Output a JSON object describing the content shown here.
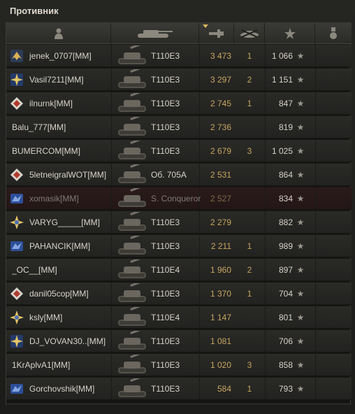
{
  "title": "Противник",
  "header": {
    "icons": [
      "player-icon",
      "tank-icon",
      "damage-icon",
      "kills-icon",
      "xp-star-icon",
      "medal-icon"
    ]
  },
  "colors": {
    "damage": "#c8a660",
    "text": "#d7d3c8",
    "dead_row": "#2b1b1b"
  },
  "rows": [
    {
      "name": "jenek_0707[MM]",
      "badge": "gold",
      "tank": "T110E3",
      "damage": "3 473",
      "kills": "1",
      "xp": "1 066",
      "dead": false
    },
    {
      "name": "Vasil7211[MM]",
      "badge": "star-blue",
      "tank": "T110E3",
      "damage": "3 297",
      "kills": "2",
      "xp": "1 151",
      "dead": false
    },
    {
      "name": "ilnurnk[MM]",
      "badge": "diamond-red",
      "tank": "T110E3",
      "damage": "2 745",
      "kills": "1",
      "xp": "847",
      "dead": false
    },
    {
      "name": "Balu_777[MM]",
      "badge": "",
      "tank": "T110E3",
      "damage": "2 736",
      "kills": "",
      "xp": "819",
      "dead": false
    },
    {
      "name": "BUMERCOM[MM]",
      "badge": "",
      "tank": "T110E3",
      "damage": "2 679",
      "kills": "3",
      "xp": "1 025",
      "dead": false
    },
    {
      "name": "5letneigralWOT[MM]",
      "badge": "diamond-red",
      "tank": "Об. 705А",
      "damage": "2 531",
      "kills": "",
      "xp": "864",
      "dead": false
    },
    {
      "name": "xomasik[MM]",
      "badge": "blue-wing",
      "tank": "S. Conqueror",
      "damage": "2 527",
      "kills": "",
      "xp": "834",
      "dead": true
    },
    {
      "name": "VARYG_____[MM]",
      "badge": "star-gold",
      "tank": "T110E3",
      "damage": "2 279",
      "kills": "",
      "xp": "882",
      "dead": false
    },
    {
      "name": "PAHANCIK[MM]",
      "badge": "blue-wing",
      "tank": "T110E3",
      "damage": "2 211",
      "kills": "1",
      "xp": "989",
      "dead": false
    },
    {
      "name": "_OC__[MM]",
      "badge": "",
      "tank": "T110E4",
      "damage": "1 960",
      "kills": "2",
      "xp": "897",
      "dead": false
    },
    {
      "name": "danil05cop[MM]",
      "badge": "diamond-red",
      "tank": "T110E3",
      "damage": "1 370",
      "kills": "1",
      "xp": "704",
      "dead": false
    },
    {
      "name": "ksly[MM]",
      "badge": "star-gold",
      "tank": "T110E4",
      "damage": "1 147",
      "kills": "",
      "xp": "801",
      "dead": false
    },
    {
      "name": "DJ_VOVAN30..[MM]",
      "badge": "star-blue",
      "tank": "T110E3",
      "damage": "1 081",
      "kills": "",
      "xp": "706",
      "dead": false
    },
    {
      "name": "1KrAplvA1[MM]",
      "badge": "",
      "tank": "T110E3",
      "damage": "1 020",
      "kills": "3",
      "xp": "858",
      "dead": false
    },
    {
      "name": "Gorchovshik[MM]",
      "badge": "blue-wing",
      "tank": "T110E3",
      "damage": "584",
      "kills": "1",
      "xp": "793",
      "dead": false
    }
  ]
}
